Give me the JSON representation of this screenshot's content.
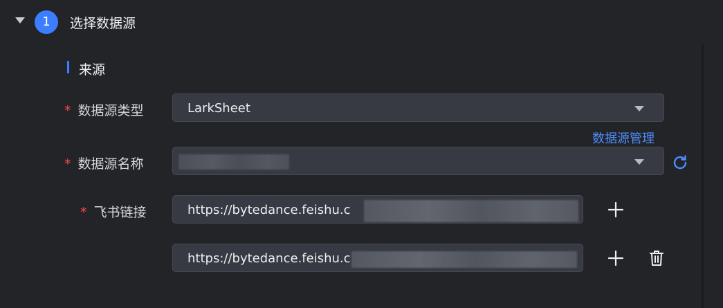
{
  "step": {
    "number": "1",
    "title": "选择数据源"
  },
  "section": {
    "title": "来源"
  },
  "form": {
    "required_mark": "*",
    "datasource_type": {
      "label": "数据源类型",
      "value": "LarkSheet"
    },
    "manage_link": "数据源管理",
    "datasource_name": {
      "label": "数据源名称",
      "value": ""
    },
    "lark_links": {
      "label": "飞书链接",
      "values": [
        "https://bytedance.feishu.c",
        "https://bytedance.feishu.c"
      ]
    }
  },
  "icons": {
    "expand": "caret-down-icon",
    "refresh": "refresh-icon",
    "add": "plus-icon",
    "delete": "trash-icon"
  },
  "colors": {
    "accent": "#3c7eff",
    "link": "#4e8cff",
    "required": "#f54a45",
    "background": "#232428",
    "field_bg": "#373a42"
  }
}
